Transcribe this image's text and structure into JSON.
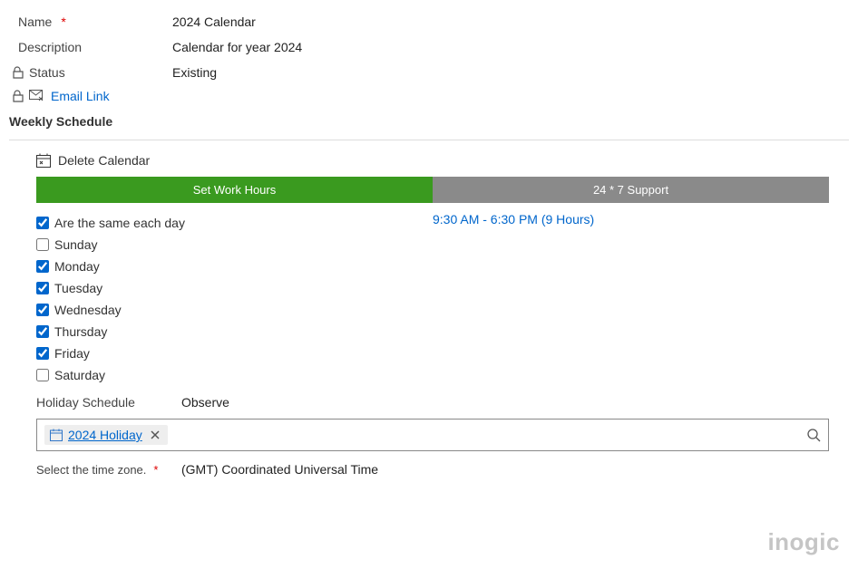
{
  "fields": {
    "name_label": "Name",
    "name_value": "2024 Calendar",
    "desc_label": "Description",
    "desc_value": "Calendar for year 2024",
    "status_label": "Status",
    "status_value": "Existing"
  },
  "email_link": "Email Link",
  "section_title": "Weekly Schedule",
  "delete_label": "Delete Calendar",
  "tabs": {
    "work_hours": "Set Work Hours",
    "support": "24 * 7 Support"
  },
  "same_each_day": "Are the same each day",
  "hours_text": "9:30 AM - 6:30 PM (9 Hours)",
  "days": {
    "sunday": "Sunday",
    "monday": "Monday",
    "tuesday": "Tuesday",
    "wednesday": "Wednesday",
    "thursday": "Thursday",
    "friday": "Friday",
    "saturday": "Saturday"
  },
  "holiday": {
    "label": "Holiday Schedule",
    "value": "Observe",
    "tag": "2024 Holiday"
  },
  "timezone": {
    "label": "Select the time zone.",
    "value": "(GMT) Coordinated Universal Time"
  },
  "watermark": "inogic",
  "required": "*"
}
